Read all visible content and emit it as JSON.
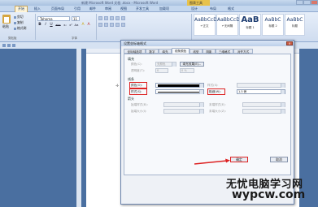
{
  "window": {
    "title": "新建 Microsoft Word 文档 .docx - Microsoft Word",
    "context_tab": "图表工具"
  },
  "tabs": [
    "开始",
    "插入",
    "页面布局",
    "引用",
    "邮件",
    "审阅",
    "视图",
    "开发工具",
    "加载项",
    "设计",
    "布局",
    "格式"
  ],
  "ribbon": {
    "paste_label": "粘贴",
    "cut_label": "剪切",
    "copy_label": "复制",
    "format_painter_label": "格式刷",
    "clipboard_group": "剪贴板",
    "font_group": "字体",
    "font_name": "Tahoma",
    "font_size": "11",
    "format_buttons": [
      "B",
      "I",
      "U",
      "abc",
      "x₂",
      "x²",
      "Aa",
      "A",
      "A"
    ],
    "styles": [
      {
        "sample": "AaBbCcD",
        "name": "↵正文"
      },
      {
        "sample": "AaBbCcD",
        "name": "↵无间隔"
      },
      {
        "sample": "AaB",
        "name": "标题 1"
      },
      {
        "sample": "AaBbC",
        "name": "标题 2"
      },
      {
        "sample": "AaBbC",
        "name": "标题"
      }
    ]
  },
  "dialog": {
    "title": "设置坐标轴格式",
    "close": "×",
    "tabs": [
      "坐标轴选项",
      "数字",
      "填充",
      "线条颜色",
      "线型",
      "阴影",
      "三维格式",
      "对齐方式"
    ],
    "fill_section": "填充",
    "fill_color_label": "颜色(C):",
    "fill_color_value": "无颜色",
    "fill_effects_button": "填充效果(E)...",
    "fill_transparency_label": "透明度(T):",
    "fill_transparency_value": "0",
    "fill_transparency_pct": "0 %",
    "line_section": "线条",
    "line_color_label": "颜色(O):",
    "line_style_label": "样式(S):",
    "line_weight_label": "粗细(W):",
    "line_weight_value": "1.5 磅",
    "transparency_label": "透明度:",
    "arrow_section": "箭头",
    "begin_style_label": "始端样式(B):",
    "begin_size_label": "始端大小(I):",
    "end_style_label": "末端样式(E):",
    "end_size_label": "末端大小(Z):",
    "ok_button": "确定",
    "cancel_button": "取消"
  },
  "watermark": {
    "line1": "无忧电脑学习网",
    "line2": "wypcw.com"
  },
  "colors": {
    "highlight": "#dd2222",
    "ribbon_bg": "#cfdcef",
    "background": "#4a6fa0"
  }
}
